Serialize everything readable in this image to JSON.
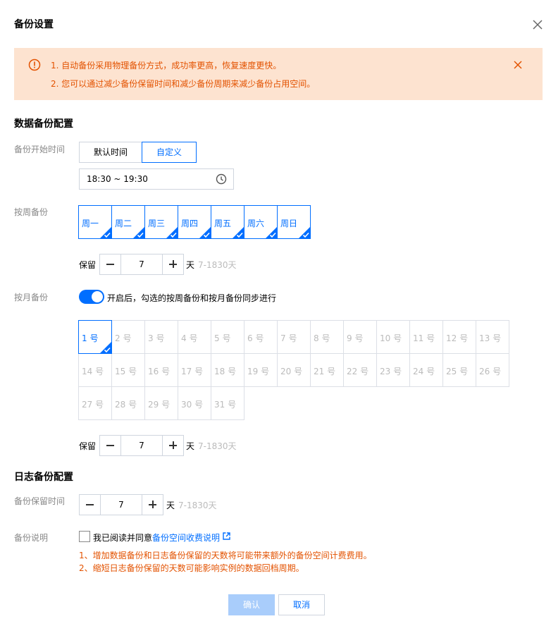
{
  "dialog": {
    "title": "备份设置"
  },
  "alert": {
    "line1": "1. 自动备份采用物理备份方式，成功率更高，恢复速度更快。",
    "line2": "2. 您可以通过减少备份保留时间和减少备份周期来减少备份占用空间。"
  },
  "data_backup": {
    "heading": "数据备份配置",
    "start_time_label": "备份开始时间",
    "mode_options": [
      "默认时间",
      "自定义"
    ],
    "mode_selected": "自定义",
    "time_value": "18:30 ~ 19:30",
    "weekly_label": "按周备份",
    "weekdays": [
      "周一",
      "周二",
      "周三",
      "周四",
      "周五",
      "周六",
      "周日"
    ],
    "weekly_retain": {
      "label": "保留",
      "value": "7",
      "unit": "天",
      "hint": "7-1830天"
    },
    "monthly_label": "按月备份",
    "monthly_toggle_on": true,
    "monthly_toggle_text": "开启后，勾选的按周备份和按月备份同步进行",
    "month_days": [
      "1 号",
      "2 号",
      "3 号",
      "4 号",
      "5 号",
      "6 号",
      "7 号",
      "8 号",
      "9 号",
      "10 号",
      "11 号",
      "12 号",
      "13 号",
      "14 号",
      "15 号",
      "16 号",
      "17 号",
      "18 号",
      "19 号",
      "20 号",
      "21 号",
      "22 号",
      "23 号",
      "24 号",
      "25 号",
      "26 号",
      "27 号",
      "28 号",
      "29 号",
      "30 号",
      "31 号"
    ],
    "month_days_selected": [
      "1 号"
    ],
    "monthly_retain": {
      "label": "保留",
      "value": "7",
      "unit": "天",
      "hint": "7-1830天"
    }
  },
  "log_backup": {
    "heading": "日志备份配置",
    "retain_label": "备份保留时间",
    "retain": {
      "value": "7",
      "unit": "天",
      "hint": "7-1830天"
    },
    "note_label": "备份说明",
    "agree_text": "我已阅读并同意",
    "agree_link": "备份空间收费说明",
    "warn1": "1、增加数据备份和日志备份保留的天数将可能带来额外的备份空间计费费用。",
    "warn2": "2、缩短日志备份保留的天数可能影响实例的数据回档周期。"
  },
  "footer": {
    "confirm": "确认",
    "cancel": "取消"
  },
  "colors": {
    "accent": "#006eff",
    "warning": "#e35200",
    "alert_bg": "#fde3d0",
    "disabled_primary": "#a9cdfb"
  }
}
